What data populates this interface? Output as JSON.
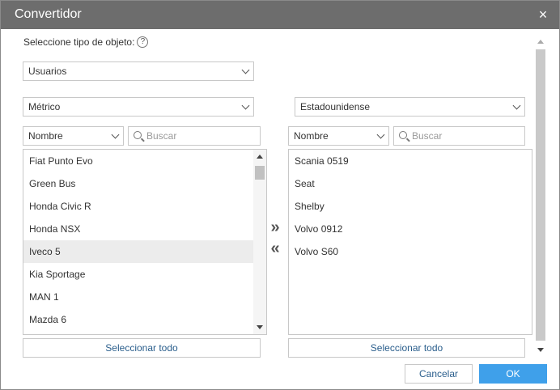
{
  "dialog": {
    "title": "Convertidor",
    "close_icon": "×"
  },
  "object_type": {
    "label": "Seleccione tipo de objeto:",
    "help_icon": "?",
    "value": "Usuarios"
  },
  "left": {
    "units": "Métrico",
    "sort": "Nombre",
    "search_placeholder": "Buscar",
    "items": [
      "Fiat Punto Evo",
      "Green Bus",
      "Honda Civic R",
      "Honda NSX",
      "Iveco 5",
      "Kia Sportage",
      "MAN 1",
      "Mazda 6"
    ],
    "highlighted_index": 4,
    "select_all": "Seleccionar todo"
  },
  "right": {
    "units": "Estadounidense",
    "sort": "Nombre",
    "search_placeholder": "Buscar",
    "items": [
      "Scania 0519",
      "Seat",
      "Shelby",
      "Volvo 0912",
      "Volvo S60"
    ],
    "select_all": "Seleccionar todo"
  },
  "move": {
    "to_right": "»",
    "to_left": "«"
  },
  "footer": {
    "cancel": "Cancelar",
    "ok": "OK"
  },
  "colors": {
    "titlebar": "#6d6d6d",
    "accent": "#3fa0ea",
    "link": "#2a5e8c"
  }
}
